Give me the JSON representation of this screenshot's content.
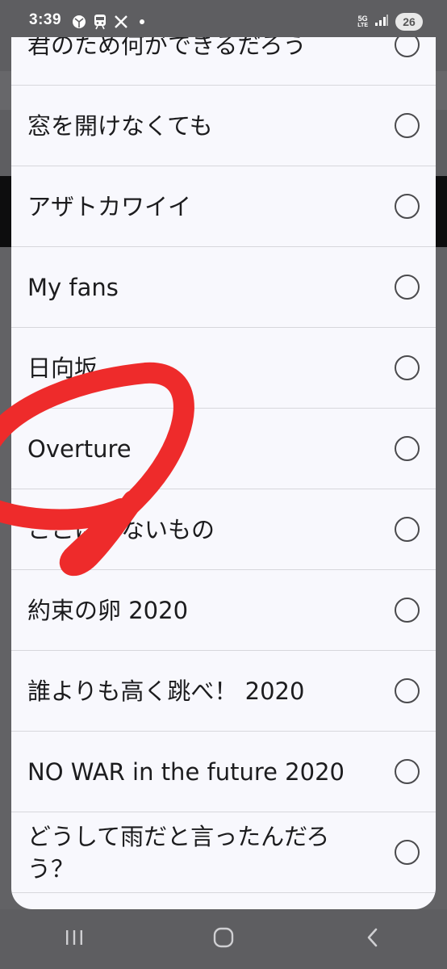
{
  "status_bar": {
    "time": "3:39",
    "network_label_top": "5G",
    "network_label_bottom": "LTE",
    "battery": "26",
    "icons": [
      "soccer-ball-icon",
      "train-icon",
      "x-logo-icon",
      "dot-icon",
      "signal-icon"
    ]
  },
  "dialog": {
    "options": [
      {
        "label": "君のため何ができるだろう"
      },
      {
        "label": "窓を開けなくても"
      },
      {
        "label": "アザトカワイイ"
      },
      {
        "label": "My fans"
      },
      {
        "label": "日向坂"
      },
      {
        "label": "Overture"
      },
      {
        "label": "ここにはないもの"
      },
      {
        "label": "約束の卵 2020"
      },
      {
        "label": "誰よりも高く跳べ！ 2020"
      },
      {
        "label": "NO WAR in the future 2020"
      },
      {
        "label": "どうして雨だと言ったんだろう？"
      }
    ],
    "radio_icon": "radio-unchecked-icon"
  },
  "annotation": {
    "color": "#ee2b2b",
    "shape": "hand-drawn-circle"
  },
  "nav_bar": {
    "icons": [
      "recents-icon",
      "home-icon",
      "back-icon"
    ]
  }
}
